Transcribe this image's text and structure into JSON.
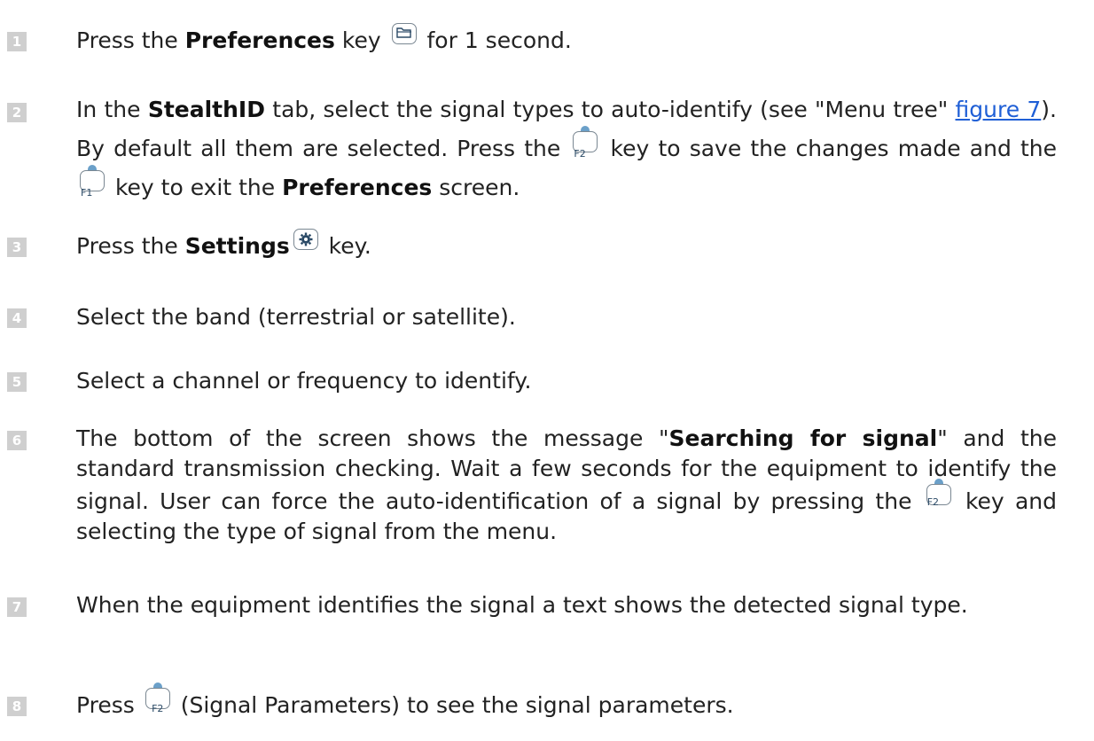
{
  "steps": [
    {
      "number": "1",
      "parts": [
        "Press the ",
        "Preferences",
        " key ",
        " for 1 second."
      ]
    },
    {
      "number": "2",
      "parts": [
        "In the ",
        "StealthID",
        " tab, select the signal types to auto-identify (see \"Menu tree\" ",
        "figure 7",
        "). By default all them are selected. Press the ",
        " key to save the changes made and the ",
        " key to exit the ",
        "Preferences",
        " screen."
      ]
    },
    {
      "number": "3",
      "parts": [
        "Press the ",
        "Settings",
        " key."
      ]
    },
    {
      "number": "4",
      "parts": [
        "Select the band (terrestrial or satellite)."
      ]
    },
    {
      "number": "5",
      "parts": [
        "Select a channel or frequency to identify."
      ]
    },
    {
      "number": "6",
      "parts": [
        "The bottom of the screen shows the message \"",
        "Searching for signal",
        "\" and the standard transmission checking. Wait a few seconds for the equipment to identify the signal. User can force the auto-identification of a signal by pressing the ",
        " key and selecting the type of signal from the menu."
      ]
    },
    {
      "number": "7",
      "parts": [
        "When the equipment identifies the signal a text shows the detected signal type."
      ]
    },
    {
      "number": "8",
      "parts": [
        "Press ",
        " (Signal Parameters) to see the signal parameters."
      ]
    }
  ],
  "keys": {
    "f1": "F1",
    "f2": "F2"
  },
  "icons": {
    "preferences": "folder-icon",
    "settings": "gear-icon",
    "function_key": "function-key-icon"
  },
  "colors": {
    "number_badge": "#cfcfcf",
    "link": "#1f5fd6",
    "text": "#222222"
  }
}
